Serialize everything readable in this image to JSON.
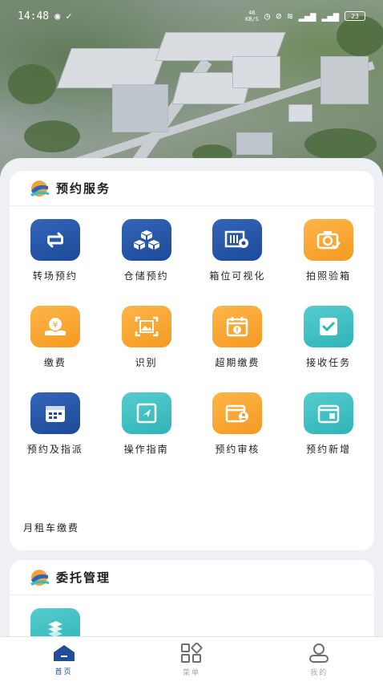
{
  "status_bar": {
    "time": "14:48",
    "net_speed_top": "46",
    "net_speed_bottom": "KB/S",
    "battery": "23"
  },
  "sections": [
    {
      "title": "预约服务",
      "items": [
        {
          "label": "转场预约",
          "icon": "swap-arrows-icon",
          "color": "blue"
        },
        {
          "label": "仓储预约",
          "icon": "boxes-icon",
          "color": "blue"
        },
        {
          "label": "箱位可视化",
          "icon": "container-eye-icon",
          "color": "blue"
        },
        {
          "label": "拍照验箱",
          "icon": "camera-check-icon",
          "color": "orange"
        },
        {
          "label": "缴费",
          "icon": "payment-hand-icon",
          "color": "orange"
        },
        {
          "label": "识别",
          "icon": "image-scan-icon",
          "color": "orange"
        },
        {
          "label": "超期缴费",
          "icon": "overdue-calendar-icon",
          "color": "orange"
        },
        {
          "label": "接收任务",
          "icon": "task-check-icon",
          "color": "teal"
        },
        {
          "label": "预约及指派",
          "icon": "calendar-grid-icon",
          "color": "blue"
        },
        {
          "label": "操作指南",
          "icon": "guide-send-icon",
          "color": "teal"
        },
        {
          "label": "预约审核",
          "icon": "calendar-user-icon",
          "color": "orange"
        },
        {
          "label": "预约新增",
          "icon": "calendar-add-icon",
          "color": "teal"
        }
      ],
      "extra_label": "月租车缴费"
    },
    {
      "title": "委托管理",
      "items": [
        {
          "label": "",
          "icon": "delegate-stack-icon",
          "color": "teal"
        }
      ]
    }
  ],
  "tabbar": [
    {
      "label": "首页",
      "icon": "home-icon",
      "active": true
    },
    {
      "label": "菜单",
      "icon": "menu-grid-icon",
      "active": false
    },
    {
      "label": "我的",
      "icon": "user-icon",
      "active": false
    }
  ],
  "colors": {
    "primary": "#214d9c",
    "orange": "#f5a02c",
    "teal": "#3cbec1",
    "background": "#eef0f3"
  }
}
